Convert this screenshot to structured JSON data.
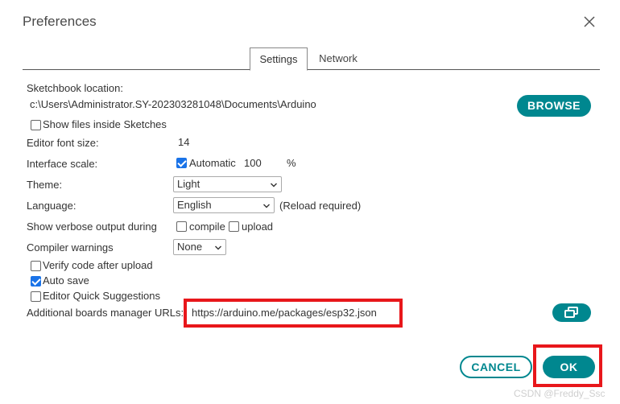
{
  "dialog": {
    "title": "Preferences"
  },
  "tabs": [
    {
      "label": "Settings",
      "active": true
    },
    {
      "label": "Network",
      "active": false
    }
  ],
  "sketchbook": {
    "label": "Sketchbook location:",
    "path": "c:\\Users\\Administrator.SY-202303281048\\Documents\\Arduino",
    "browse_label": "BROWSE",
    "show_files_label": "Show files inside Sketches",
    "show_files_checked": false
  },
  "editor_font": {
    "label": "Editor font size:",
    "value": "14"
  },
  "interface_scale": {
    "label": "Interface scale:",
    "automatic_label": "Automatic",
    "automatic_checked": true,
    "value": "100",
    "unit": "%"
  },
  "theme": {
    "label": "Theme:",
    "selected": "Light"
  },
  "language": {
    "label": "Language:",
    "selected": "English",
    "note": "(Reload required)"
  },
  "verbose": {
    "label": "Show verbose output during",
    "compile_label": "compile",
    "compile_checked": false,
    "upload_label": "upload",
    "upload_checked": false
  },
  "compiler_warnings": {
    "label": "Compiler warnings",
    "selected": "None"
  },
  "options": [
    {
      "label": "Verify code after upload",
      "checked": false
    },
    {
      "label": "Auto save",
      "checked": true
    },
    {
      "label": "Editor Quick Suggestions",
      "checked": false
    }
  ],
  "boards_urls": {
    "label": "Additional boards manager URLs:",
    "value": "https://arduino.me/packages/esp32.json",
    "edit_icon": "open-window-icon"
  },
  "footer": {
    "cancel_label": "CANCEL",
    "ok_label": "OK"
  },
  "watermark": "CSDN @Freddy_Ssc",
  "colors": {
    "accent": "#00878f",
    "highlight": "#e8171b",
    "checkbox": "#1a73e8"
  }
}
